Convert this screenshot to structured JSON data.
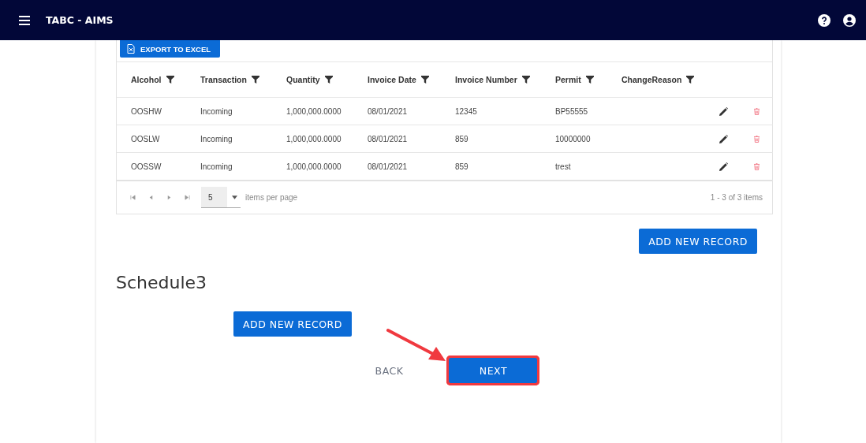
{
  "app_bar": {
    "title": "TABC - AIMS"
  },
  "grid": {
    "export_button": "EXPORT TO EXCEL",
    "columns": [
      {
        "label": "Alcohol"
      },
      {
        "label": "Transaction"
      },
      {
        "label": "Quantity"
      },
      {
        "label": "Invoice Date"
      },
      {
        "label": "Invoice Number"
      },
      {
        "label": "Permit"
      },
      {
        "label": "ChangeReason"
      }
    ],
    "rows": [
      {
        "cells": [
          "OOSHW",
          "Incoming",
          "1,000,000.0000",
          "08/01/2021",
          "12345",
          "BP55555"
        ]
      },
      {
        "cells": [
          "OOSLW",
          "Incoming",
          "1,000,000.0000",
          "08/01/2021",
          "859",
          "10000000"
        ]
      },
      {
        "cells": [
          "OOSSW",
          "Incoming",
          "1,000,000.0000",
          "08/01/2021",
          "859",
          "trest"
        ]
      }
    ],
    "pager": {
      "page_size": "5",
      "page_size_label": "items per page",
      "info": "1 - 3 of 3 items"
    }
  },
  "add_record_button": "ADD NEW RECORD",
  "section": {
    "title": "Schedule3",
    "add_record_button": "ADD NEW RECORD"
  },
  "nav_buttons": [
    {
      "label": "BACK",
      "kind": "text",
      "highlighted": false
    },
    {
      "label": "NEXT",
      "kind": "primary",
      "highlighted": true
    }
  ]
}
